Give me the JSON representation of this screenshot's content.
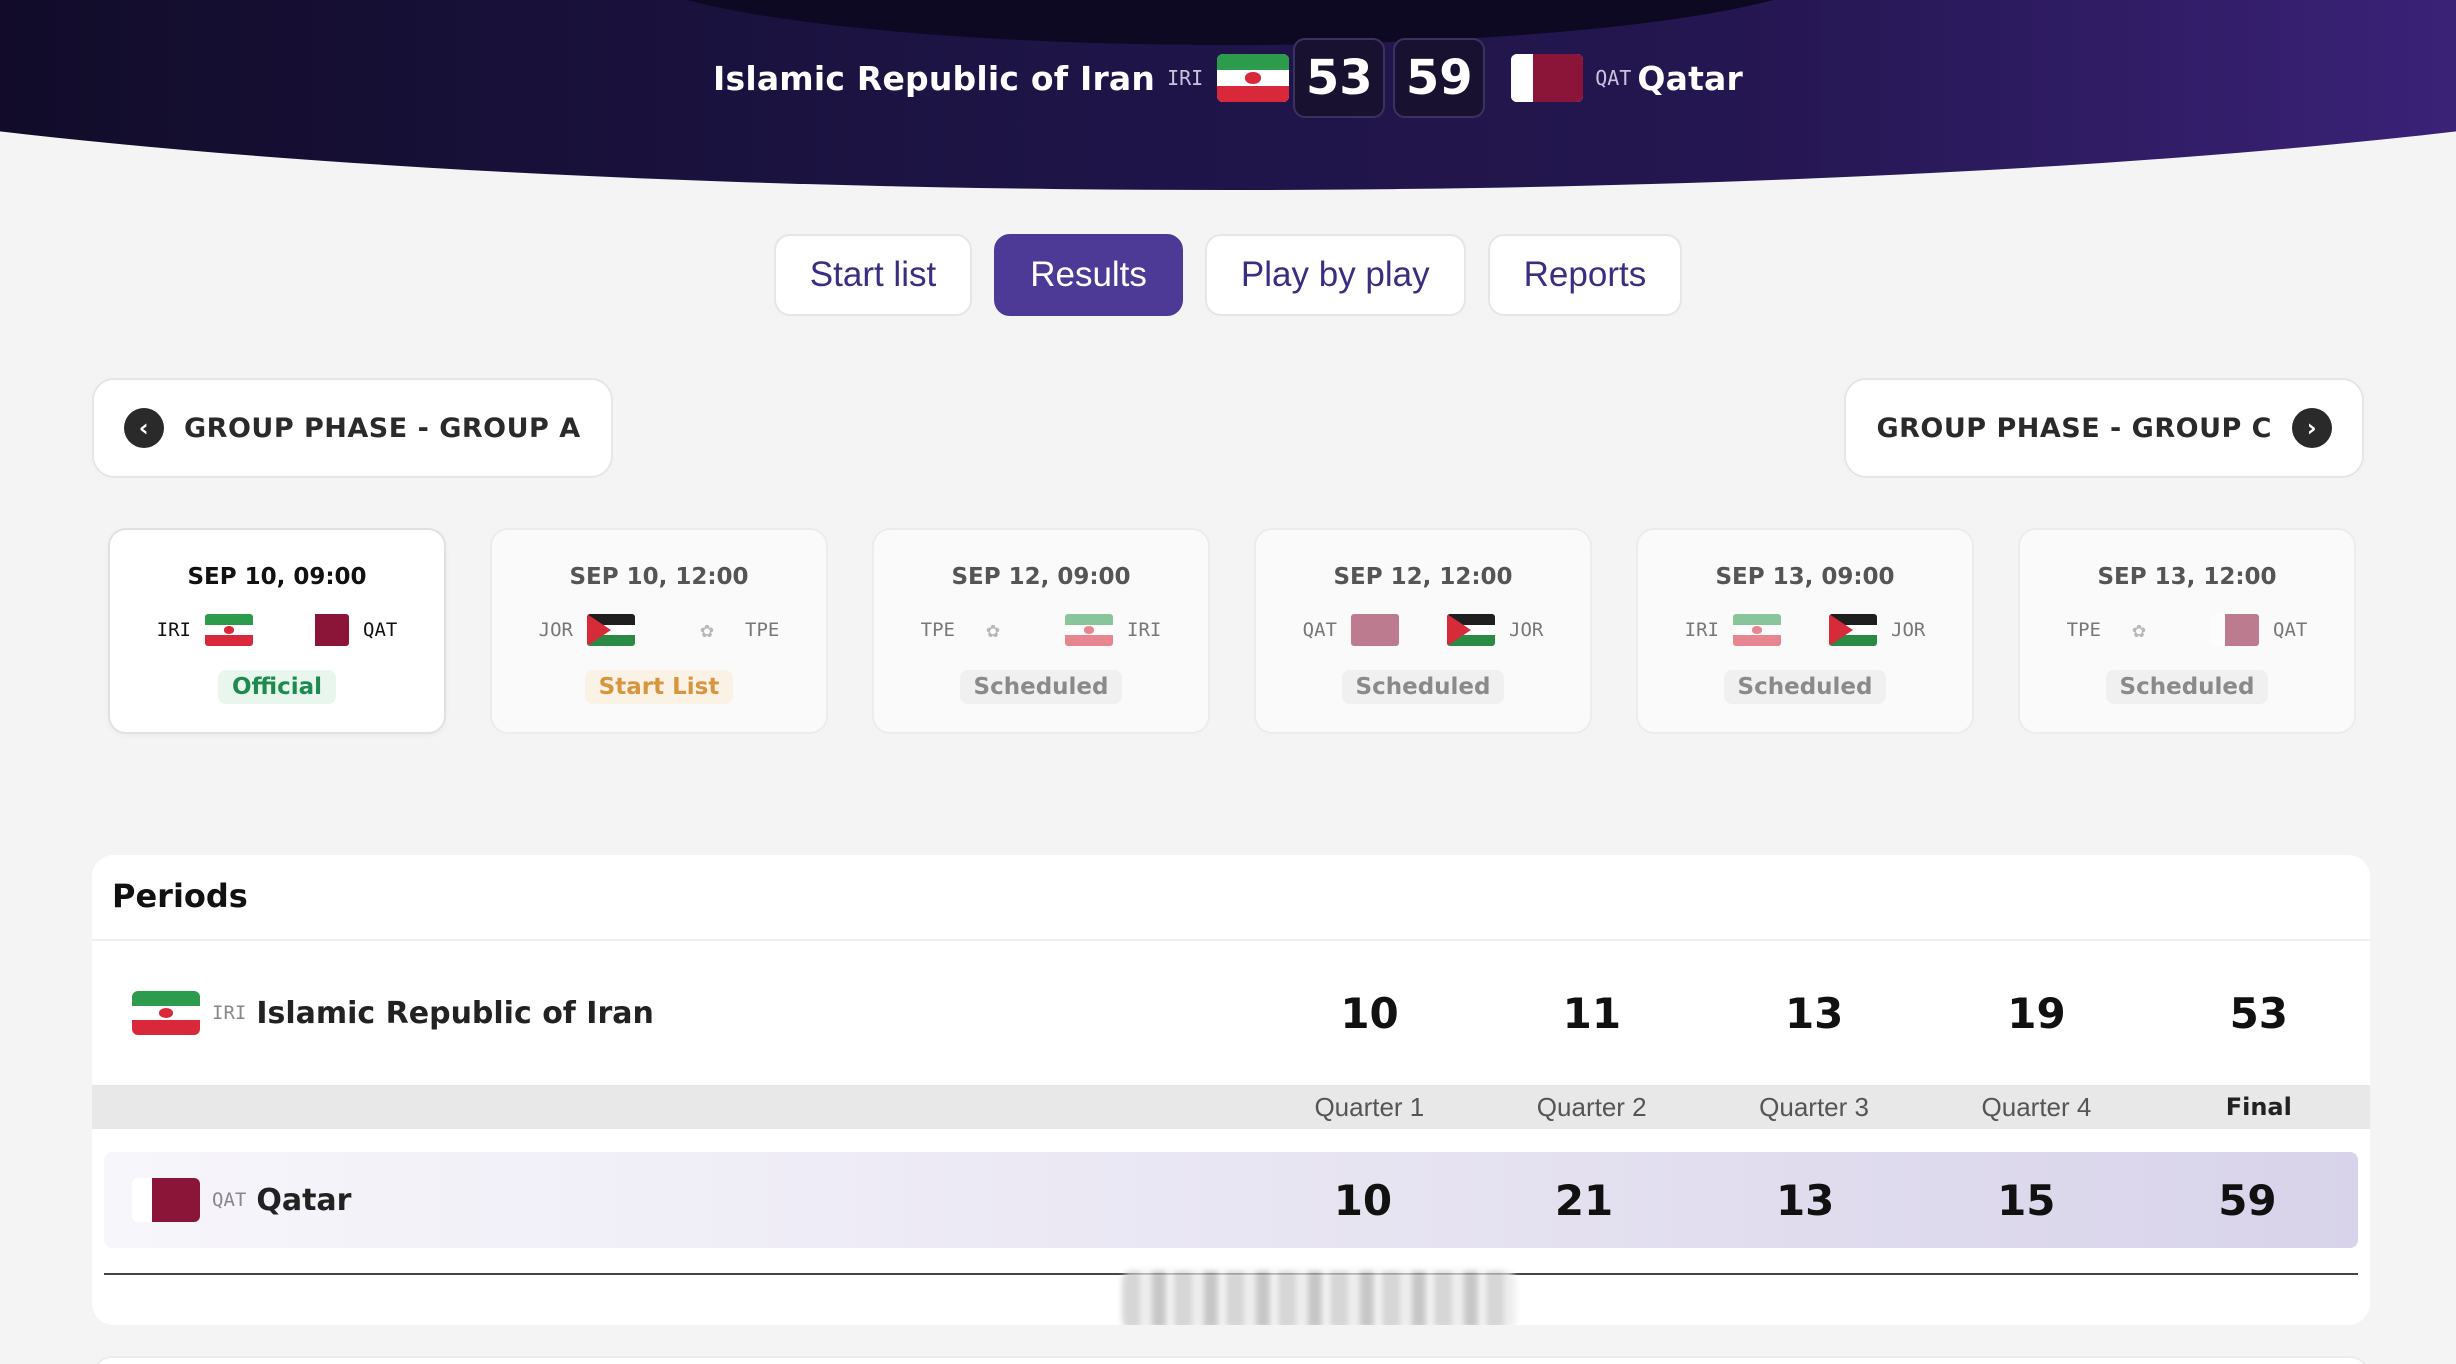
{
  "header": {
    "home": {
      "name": "Islamic Republic of Iran",
      "code": "IRI",
      "score": "53"
    },
    "away": {
      "name": "Qatar",
      "code": "QAT",
      "score": "59"
    }
  },
  "tabs": [
    {
      "label": "Start list"
    },
    {
      "label": "Results",
      "active": true
    },
    {
      "label": "Play by play"
    },
    {
      "label": "Reports"
    }
  ],
  "group_nav": {
    "prev_label": "GROUP PHASE - GROUP A",
    "next_label": "GROUP PHASE - GROUP C"
  },
  "games": [
    {
      "date": "SEP 10, 09:00",
      "team1": "IRI",
      "team2": "QAT",
      "status": "Official"
    },
    {
      "date": "SEP 10, 12:00",
      "team1": "JOR",
      "team2": "TPE",
      "status": "Start List"
    },
    {
      "date": "SEP 12, 09:00",
      "team1": "TPE",
      "team2": "IRI",
      "status": "Scheduled"
    },
    {
      "date": "SEP 12, 12:00",
      "team1": "QAT",
      "team2": "JOR",
      "status": "Scheduled"
    },
    {
      "date": "SEP 13, 09:00",
      "team1": "IRI",
      "team2": "JOR",
      "status": "Scheduled"
    },
    {
      "date": "SEP 13, 12:00",
      "team1": "TPE",
      "team2": "QAT",
      "status": "Scheduled"
    }
  ],
  "periods": {
    "title": "Periods",
    "labels": [
      "Quarter 1",
      "Quarter 2",
      "Quarter 3",
      "Quarter 4",
      "Final"
    ],
    "home": {
      "code": "IRI",
      "name": "Islamic Republic of Iran",
      "scores": [
        "10",
        "11",
        "13",
        "19",
        "53"
      ]
    },
    "away": {
      "code": "QAT",
      "name": "Qatar",
      "scores": [
        "10",
        "21",
        "13",
        "15",
        "59"
      ]
    }
  },
  "colors": {
    "accent": "#4d3a96",
    "official": "#1d8a4e",
    "start_list": "#d8953f",
    "scheduled": "#8a8a8a"
  }
}
